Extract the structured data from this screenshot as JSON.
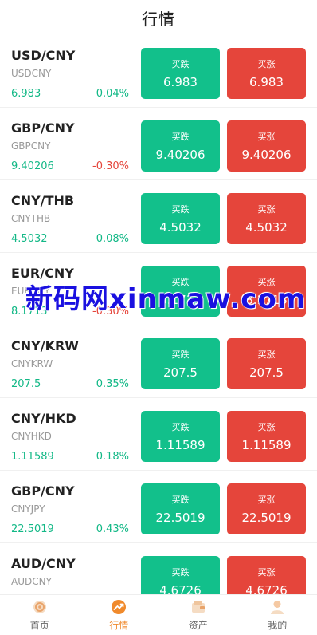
{
  "header": {
    "title": "行情"
  },
  "buttons": {
    "sell_label": "买跌",
    "buy_label": "买涨"
  },
  "rows": [
    {
      "pair": "USD/CNY",
      "code": "USDCNY",
      "price": "6.983",
      "change": "0.04%",
      "trend": "up",
      "sell": "6.983",
      "buy": "6.983"
    },
    {
      "pair": "GBP/CNY",
      "code": "GBPCNY",
      "price": "9.40206",
      "change": "-0.30%",
      "trend": "down",
      "sell": "9.40206",
      "buy": "9.40206"
    },
    {
      "pair": "CNY/THB",
      "code": "CNYTHB",
      "price": "4.5032",
      "change": "0.08%",
      "trend": "up",
      "sell": "4.5032",
      "buy": "4.5032"
    },
    {
      "pair": "EUR/CNY",
      "code": "EURCNY",
      "price": "8.1713",
      "change": "-0.30%",
      "trend": "down",
      "sell": "8.1713",
      "buy": "8.1713"
    },
    {
      "pair": "CNY/KRW",
      "code": "CNYKRW",
      "price": "207.5",
      "change": "0.35%",
      "trend": "up",
      "sell": "207.5",
      "buy": "207.5"
    },
    {
      "pair": "CNY/HKD",
      "code": "CNYHKD",
      "price": "1.11589",
      "change": "0.18%",
      "trend": "up",
      "sell": "1.11589",
      "buy": "1.11589"
    },
    {
      "pair": "GBP/CNY",
      "code": "CNYJPY",
      "price": "22.5019",
      "change": "0.43%",
      "trend": "up",
      "sell": "22.5019",
      "buy": "22.5019"
    },
    {
      "pair": "AUD/CNY",
      "code": "AUDCNY",
      "price": "4.6726",
      "change": "",
      "trend": "up",
      "sell": "4.6726",
      "buy": "4.6726"
    }
  ],
  "watermark": {
    "text": "新码网xinmaw.com"
  },
  "tabbar": {
    "items": [
      {
        "label": "首页",
        "icon": "home-icon",
        "active": false
      },
      {
        "label": "行情",
        "icon": "market-trend-icon",
        "active": true
      },
      {
        "label": "资产",
        "icon": "wallet-icon",
        "active": false
      },
      {
        "label": "我的",
        "icon": "user-icon",
        "active": false
      }
    ]
  },
  "colors": {
    "up": "#12b886",
    "down": "#e5453b",
    "sell_bg": "#12c08b",
    "buy_bg": "#e5453b",
    "active_tab": "#f08a2c"
  }
}
